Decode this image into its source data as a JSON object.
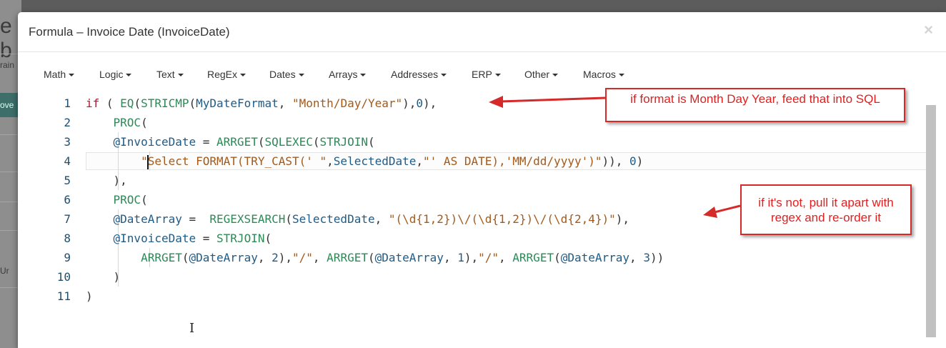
{
  "background": {
    "fragment_top": "e b",
    "fragment_rain": "rain",
    "fragment_button": "ove",
    "fragment_ur": "Ur"
  },
  "modal": {
    "title": "Formula – Invoice Date (InvoiceDate)",
    "close_glyph": "×"
  },
  "toolbar": {
    "menus": [
      {
        "label": "Math"
      },
      {
        "label": "Logic"
      },
      {
        "label": "Text"
      },
      {
        "label": "RegEx"
      },
      {
        "label": "Dates"
      },
      {
        "label": "Arrays"
      },
      {
        "label": "Addresses"
      },
      {
        "label": "ERP"
      },
      {
        "label": "Other"
      },
      {
        "label": "Macros"
      }
    ]
  },
  "editor": {
    "line_numbers": [
      "1",
      "2",
      "3",
      "4",
      "5",
      "6",
      "7",
      "8",
      "9",
      "10",
      "11"
    ],
    "lines": [
      [
        {
          "t": "kw",
          "v": "if"
        },
        {
          "t": "p",
          "v": " ( "
        },
        {
          "t": "fn",
          "v": "EQ"
        },
        {
          "t": "p",
          "v": "("
        },
        {
          "t": "fn",
          "v": "STRICMP"
        },
        {
          "t": "p",
          "v": "("
        },
        {
          "t": "var",
          "v": "MyDateFormat"
        },
        {
          "t": "p",
          "v": ", "
        },
        {
          "t": "str",
          "v": "\"Month/Day/Year\""
        },
        {
          "t": "p",
          "v": "),"
        },
        {
          "t": "num",
          "v": "0"
        },
        {
          "t": "p",
          "v": "),"
        }
      ],
      [
        {
          "t": "p",
          "v": "    "
        },
        {
          "t": "fn",
          "v": "PROC"
        },
        {
          "t": "p",
          "v": "("
        }
      ],
      [
        {
          "t": "p",
          "v": "    "
        },
        {
          "t": "var",
          "v": "@InvoiceDate"
        },
        {
          "t": "p",
          "v": " = "
        },
        {
          "t": "fn",
          "v": "ARRGET"
        },
        {
          "t": "p",
          "v": "("
        },
        {
          "t": "fn",
          "v": "SQLEXEC"
        },
        {
          "t": "p",
          "v": "("
        },
        {
          "t": "fn",
          "v": "STRJOIN"
        },
        {
          "t": "p",
          "v": "("
        }
      ],
      [
        {
          "t": "p",
          "v": "        "
        },
        {
          "t": "str",
          "v": "\"Select FORMAT(TRY_CAST(' \""
        },
        {
          "t": "p",
          "v": ","
        },
        {
          "t": "var",
          "v": "SelectedDate"
        },
        {
          "t": "p",
          "v": ","
        },
        {
          "t": "str",
          "v": "\"' AS DATE),'MM/dd/yyyy')\""
        },
        {
          "t": "p",
          "v": ")), "
        },
        {
          "t": "num",
          "v": "0"
        },
        {
          "t": "p",
          "v": ")"
        }
      ],
      [
        {
          "t": "p",
          "v": "    ),"
        }
      ],
      [
        {
          "t": "p",
          "v": "    "
        },
        {
          "t": "fn",
          "v": "PROC"
        },
        {
          "t": "p",
          "v": "("
        }
      ],
      [
        {
          "t": "p",
          "v": "    "
        },
        {
          "t": "var",
          "v": "@DateArray"
        },
        {
          "t": "p",
          "v": " =  "
        },
        {
          "t": "fn",
          "v": "REGEXSEARCH"
        },
        {
          "t": "p",
          "v": "("
        },
        {
          "t": "var",
          "v": "SelectedDate"
        },
        {
          "t": "p",
          "v": ", "
        },
        {
          "t": "str",
          "v": "\"(\\d{1,2})\\/(\\d{1,2})\\/(\\d{2,4})\""
        },
        {
          "t": "p",
          "v": "),"
        }
      ],
      [
        {
          "t": "p",
          "v": "    "
        },
        {
          "t": "var",
          "v": "@InvoiceDate"
        },
        {
          "t": "p",
          "v": " = "
        },
        {
          "t": "fn",
          "v": "STRJOIN"
        },
        {
          "t": "p",
          "v": "("
        }
      ],
      [
        {
          "t": "p",
          "v": "        "
        },
        {
          "t": "fn",
          "v": "ARRGET"
        },
        {
          "t": "p",
          "v": "("
        },
        {
          "t": "var",
          "v": "@DateArray"
        },
        {
          "t": "p",
          "v": ", "
        },
        {
          "t": "num",
          "v": "2"
        },
        {
          "t": "p",
          "v": "),"
        },
        {
          "t": "str",
          "v": "\"/\""
        },
        {
          "t": "p",
          "v": ", "
        },
        {
          "t": "fn",
          "v": "ARRGET"
        },
        {
          "t": "p",
          "v": "("
        },
        {
          "t": "var",
          "v": "@DateArray"
        },
        {
          "t": "p",
          "v": ", "
        },
        {
          "t": "num",
          "v": "1"
        },
        {
          "t": "p",
          "v": "),"
        },
        {
          "t": "str",
          "v": "\"/\""
        },
        {
          "t": "p",
          "v": ", "
        },
        {
          "t": "fn",
          "v": "ARRGET"
        },
        {
          "t": "p",
          "v": "("
        },
        {
          "t": "var",
          "v": "@DateArray"
        },
        {
          "t": "p",
          "v": ", "
        },
        {
          "t": "num",
          "v": "3"
        },
        {
          "t": "p",
          "v": "))"
        }
      ],
      [
        {
          "t": "p",
          "v": "    )"
        }
      ],
      [
        {
          "t": "p",
          "v": ")"
        }
      ]
    ]
  },
  "annotations": {
    "note1": "if format is Month Day Year, feed that into SQL",
    "note2": "if it's not, pull it apart with regex and re-order it"
  },
  "colors": {
    "keyword": "#b8162e",
    "function": "#2c8a57",
    "variable": "#1e5b87",
    "string": "#a35a1b",
    "annotation": "#e02020"
  }
}
